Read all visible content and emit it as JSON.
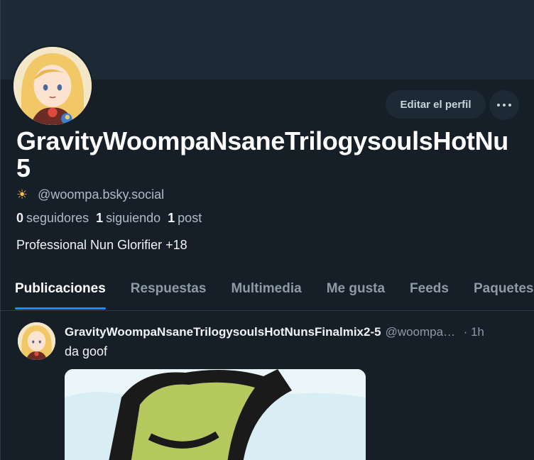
{
  "profile": {
    "display_name": "GravityWoompaNsaneTrilogysoulsHotNunsFinalmix2-5",
    "display_name_line1": "GravityWoompaNsaneTrilogysoulsHotNu",
    "display_name_line2": "5",
    "handle_emoji": "☀",
    "handle": "@woompa.bsky.social",
    "followers_count": "0",
    "followers_label": "seguidores",
    "following_count": "1",
    "following_label": "siguiendo",
    "posts_count": "1",
    "posts_label": "post",
    "bio": "Professional Nun Glorifier +18",
    "edit_label": "Editar el perfil"
  },
  "tabs": [
    {
      "label": "Publicaciones",
      "active": true
    },
    {
      "label": "Respuestas"
    },
    {
      "label": "Multimedia"
    },
    {
      "label": "Me gusta"
    },
    {
      "label": "Feeds"
    },
    {
      "label": "Paquetes"
    }
  ],
  "post": {
    "author": "GravityWoompaNsaneTrilogysoulsHotNunsFinalmix2-5",
    "handle": "@woompa.bsky.social",
    "time": "· 1h",
    "text": "da goof"
  },
  "colors": {
    "background": "#161e27",
    "banner": "#1e2936",
    "accent": "#1a8cff",
    "muted": "#8d9aa8"
  },
  "icons": {
    "more": "more-horizontal-icon",
    "handle_emoji": "sun-icon"
  }
}
